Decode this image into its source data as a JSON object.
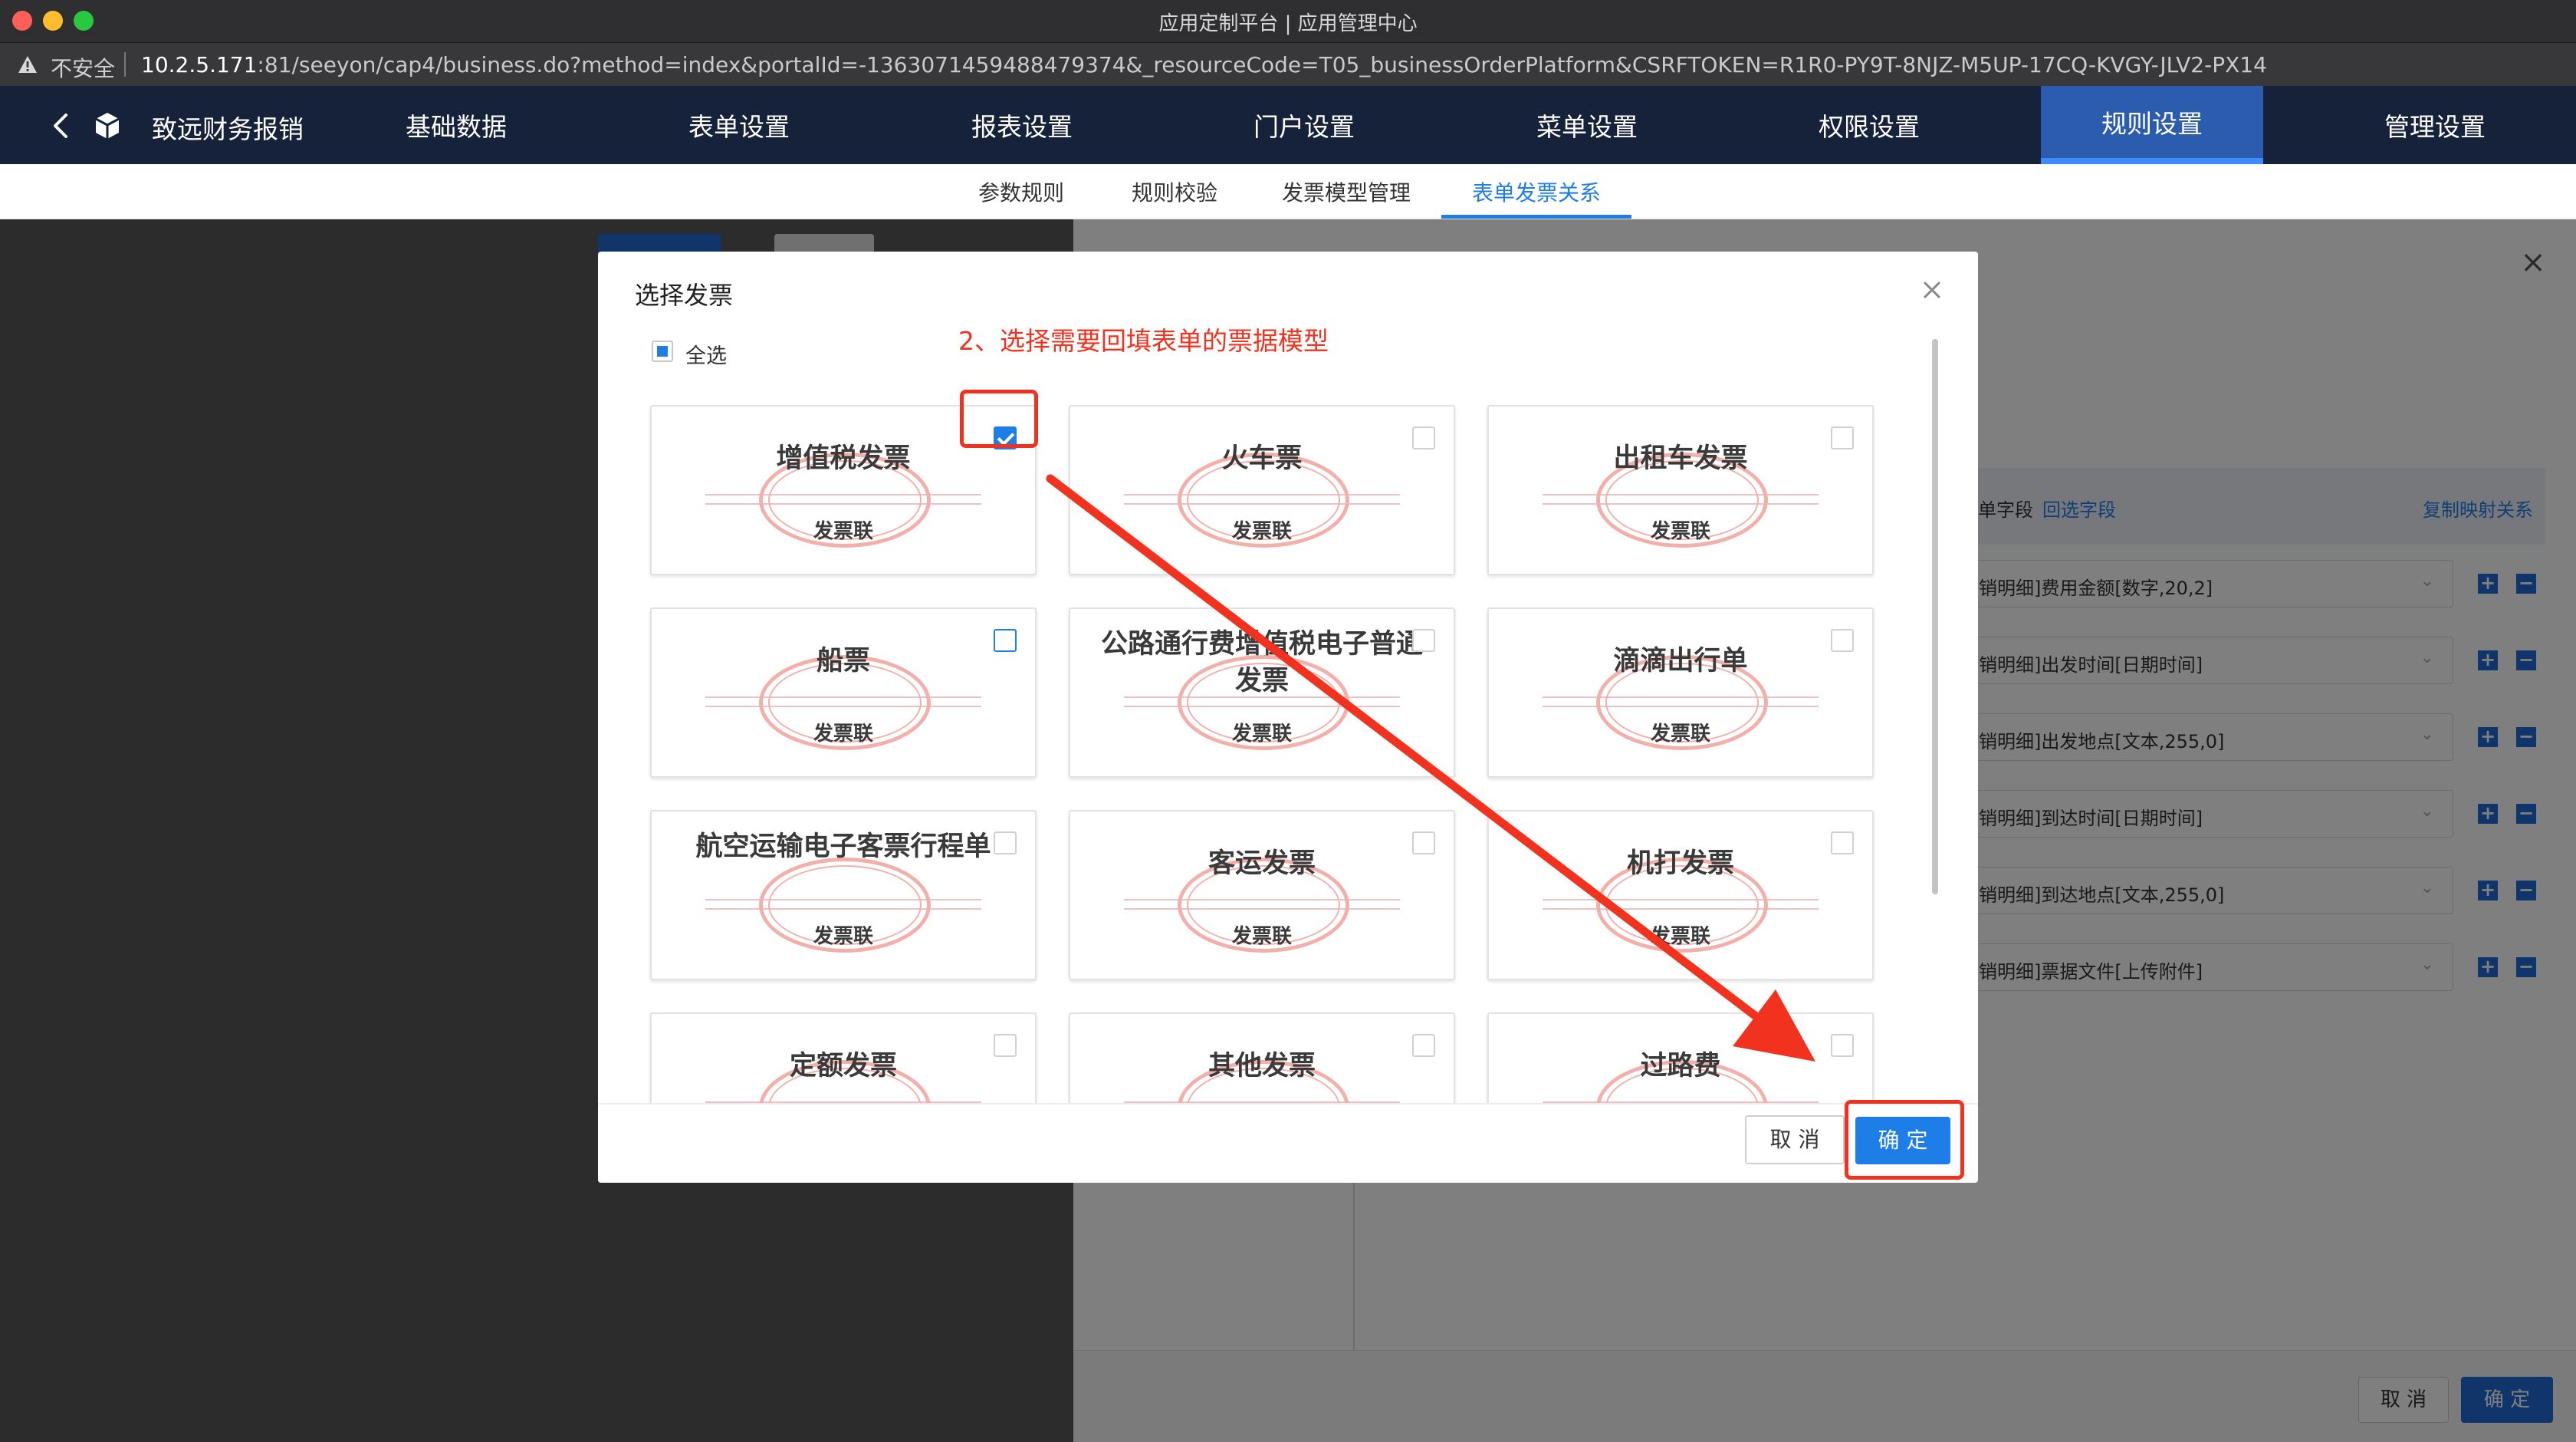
{
  "window": {
    "title": "应用定制平台 | 应用管理中心"
  },
  "address_bar": {
    "security_label": "不安全",
    "url_host": "10.2.5.171",
    "url_rest": ":81/seeyon/cap4/business.do?method=index&portalId=-1363071459488479374&_resourceCode=T05_businessOrderPlatform&CSRFTOKEN=R1R0-PY9T-8NJZ-M5UP-17CQ-KVGY-JLV2-PX14"
  },
  "app_nav": {
    "brand": "致远财务报销",
    "items": [
      {
        "label": "基础数据"
      },
      {
        "label": "表单设置"
      },
      {
        "label": "报表设置"
      },
      {
        "label": "门户设置"
      },
      {
        "label": "菜单设置"
      },
      {
        "label": "权限设置"
      },
      {
        "label": "规则设置",
        "active": true
      },
      {
        "label": "管理设置"
      }
    ]
  },
  "sub_tabs": [
    {
      "label": "参数规则"
    },
    {
      "label": "规则校验"
    },
    {
      "label": "发票模型管理"
    },
    {
      "label": "表单发票关系",
      "active": true
    }
  ],
  "background_panel": {
    "header_left": "单字段",
    "header_link": "回选字段",
    "header_right": "复制映射关系",
    "rows": [
      "销明细]费用金额[数字,20,2]",
      "销明细]出发时间[日期时间]",
      "销明细]出发地点[文本,255,0]",
      "销明细]到达时间[日期时间]",
      "销明细]到达地点[文本,255,0]",
      "销明细]票据文件[上传附件]"
    ],
    "cancel_label": "取 消",
    "ok_label": "确 定"
  },
  "modal": {
    "title": "选择发票",
    "select_all_label": "全选",
    "annotation": "2、选择需要回填表单的票据模型",
    "card_subtitle": "发票联",
    "invoices": [
      {
        "name": "增值税发票",
        "checked": true
      },
      {
        "name": "火车票",
        "checked": false
      },
      {
        "name": "出租车发票",
        "checked": false
      },
      {
        "name": "船票",
        "checked": false
      },
      {
        "name": "公路通行费增值税电子普通发票",
        "checked": false
      },
      {
        "name": "滴滴出行单",
        "checked": false
      },
      {
        "name": "航空运输电子客票行程单",
        "checked": false
      },
      {
        "name": "客运发票",
        "checked": false
      },
      {
        "name": "机打发票",
        "checked": false
      },
      {
        "name": "定额发票",
        "checked": false
      },
      {
        "name": "其他发票",
        "checked": false
      },
      {
        "name": "过路费",
        "checked": false
      }
    ],
    "cancel_label": "取 消",
    "ok_label": "确 定"
  },
  "colors": {
    "nav_bg": "#16213a",
    "accent": "#1e7ee8",
    "annotation": "#f0321e"
  }
}
